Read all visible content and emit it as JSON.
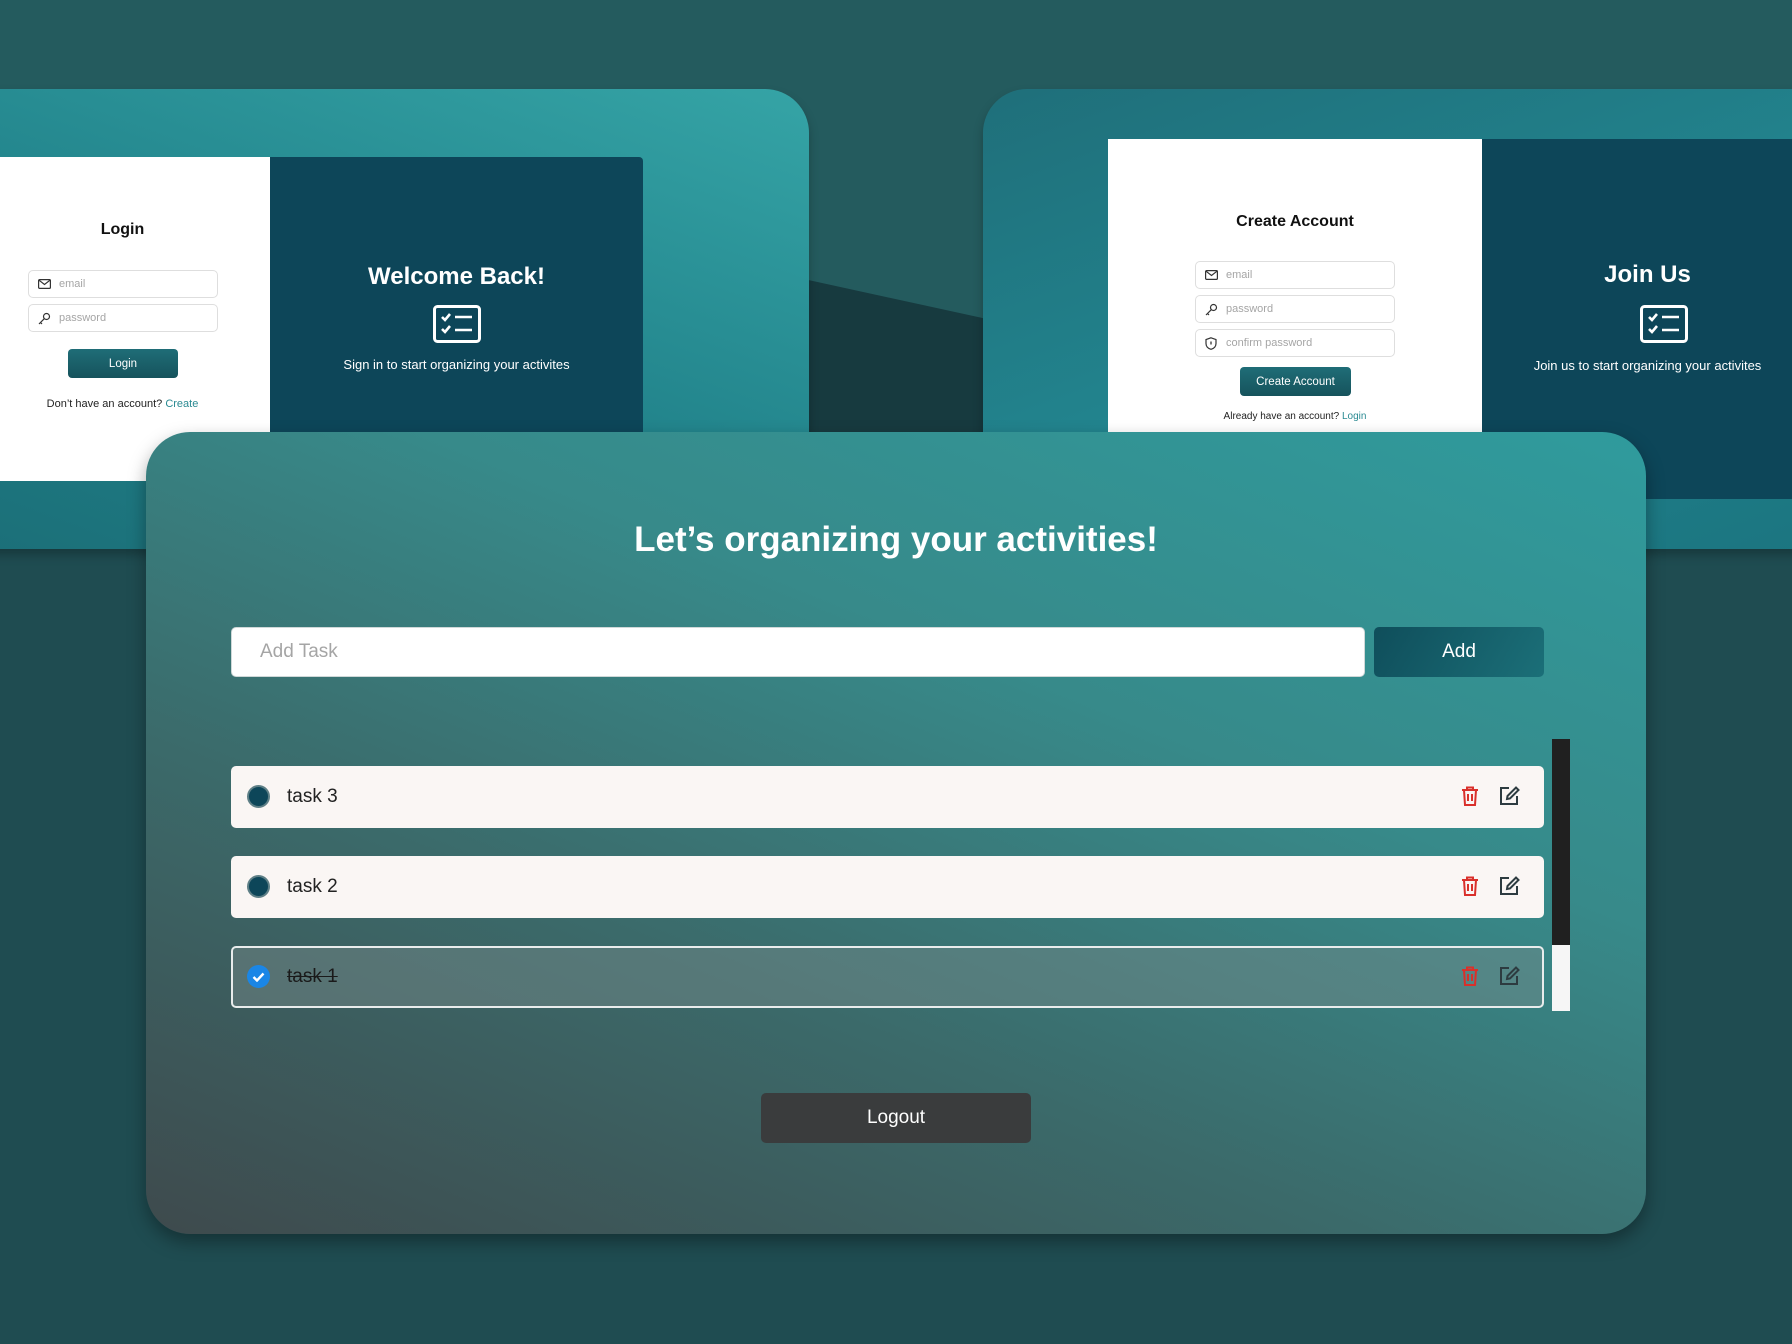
{
  "login_mockup": {
    "title": "Login",
    "email_placeholder": "email",
    "password_placeholder": "password",
    "login_button": "Login",
    "footer_text": "Don’t have an account?",
    "footer_link": "Create",
    "panel_title": "Welcome Back!",
    "panel_subtitle": "Sign in to start organizing your activites"
  },
  "create_mockup": {
    "title": "Create Account",
    "email_placeholder": "email",
    "password_placeholder": "password",
    "confirm_placeholder": "confirm password",
    "create_button": "Create Account",
    "footer_text": "Already have an account?",
    "footer_link": "Login",
    "panel_title": "Join Us",
    "panel_subtitle": "Join us to start organizing your activites"
  },
  "todo": {
    "title": "Let’s organizing your activities!",
    "input_placeholder": "Add Task",
    "add_button": "Add",
    "tasks": [
      {
        "label": "task 3",
        "done": false
      },
      {
        "label": "task 2",
        "done": false
      },
      {
        "label": "task 1",
        "done": true
      }
    ],
    "logout_button": "Logout"
  },
  "colors": {
    "page_bg": "#245b5e",
    "panel_dark": "#0d4659",
    "accent_teal": "#2a8a92",
    "delete_red": "#d9302b",
    "check_blue": "#1a86e6"
  }
}
